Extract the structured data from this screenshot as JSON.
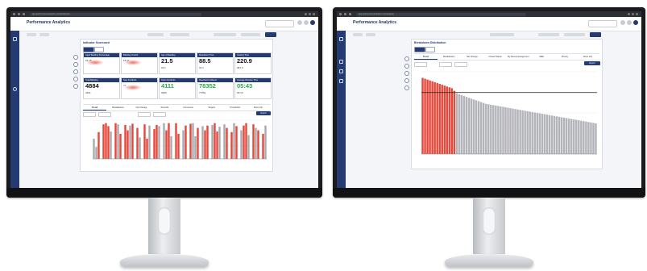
{
  "app": {
    "title": "Performance Analytics",
    "url_left": "app.performanceanalytics.com/dashboard",
    "url_right": "app.performanceanalytics.com/analysis"
  },
  "left_screen": {
    "page_title": "Indicator Scorecard",
    "cards": [
      {
        "label": "Aged Backlog Percentage",
        "value": "",
        "sub": "24.15",
        "color": "red"
      },
      {
        "label": "Backlog Growth",
        "value": "",
        "sub": "18.37",
        "color": "red"
      },
      {
        "label": "Age of Backlog",
        "value": "21.5",
        "sub": "22.1",
        "color": "black"
      },
      {
        "label": "Resolution Time",
        "value": "88.5",
        "sub": "31.1",
        "color": "black"
      },
      {
        "label": "Closing Time",
        "value": "220.9",
        "sub": "287.9",
        "color": "black"
      },
      {
        "label": "Total Backlog",
        "value": "4884",
        "sub": "4421",
        "color": "black"
      },
      {
        "label": "New Incidents",
        "value": "",
        "sub": "77",
        "color": "red"
      },
      {
        "label": "Open Incidents",
        "value": "4111",
        "sub": "3945",
        "color": "green"
      },
      {
        "label": "Resolved Incidents",
        "value": "78352",
        "sub": "77254",
        "color": "green"
      },
      {
        "label": "Average Resolve Time",
        "value": "05:43",
        "sub": "06:10",
        "color": "green"
      }
    ],
    "tabs": [
      "Trend",
      "Breakdowns",
      "Net Change",
      "Records",
      "Comments",
      "Targets",
      "Thresholds",
      "More Info"
    ],
    "export_label": "Export",
    "chart_data": {
      "type": "bar",
      "colors": {
        "highlight": "#e5473a",
        "base": "#a9aab0"
      },
      "values": [
        34,
        20,
        45,
        0,
        58,
        60,
        55,
        46,
        0,
        60,
        58,
        42,
        0,
        57,
        48,
        56,
        59,
        0,
        52,
        36,
        0,
        58,
        34,
        56,
        0,
        50,
        57,
        55,
        0,
        60,
        48,
        60,
        38,
        0,
        60,
        42,
        0,
        48,
        56,
        0,
        59,
        60,
        38,
        52,
        0,
        55,
        48,
        56,
        0,
        57,
        60,
        46,
        54,
        0,
        58,
        52,
        0,
        45,
        60,
        55,
        0,
        48,
        56,
        60,
        40,
        0,
        58,
        52,
        48,
        0,
        42,
        56
      ],
      "highlight": [
        false,
        false,
        true,
        false,
        true,
        true,
        true,
        false,
        false,
        true,
        false,
        true,
        false,
        true,
        true,
        false,
        true,
        false,
        true,
        false,
        false,
        true,
        true,
        false,
        false,
        true,
        true,
        false,
        false,
        false,
        true,
        true,
        false,
        false,
        true,
        true,
        false,
        false,
        true,
        false,
        true,
        false,
        false,
        true,
        false,
        false,
        true,
        true,
        false,
        false,
        true,
        true,
        false,
        false,
        false,
        true,
        false,
        true,
        false,
        true,
        false,
        false,
        true,
        true,
        false,
        false,
        true,
        false,
        true,
        false,
        true,
        false
      ]
    }
  },
  "right_screen": {
    "page_title": "Breakdown Distribution",
    "tabs": [
      "Trend",
      "Breakdowns",
      "Net Change",
      "Closed Status",
      "By Record Assignment",
      "SME",
      "Priority",
      "More Info"
    ],
    "export_label": "Export",
    "chart_data": {
      "type": "bar",
      "colors": {
        "highlight": "#e5473a",
        "base": "#b3b4b9",
        "threshold": "#222222"
      },
      "threshold": 71,
      "highlight_count": 14,
      "values": [
        88,
        87,
        86,
        85,
        84,
        83,
        82,
        81,
        80,
        79,
        78,
        77,
        76,
        73,
        70,
        69,
        68,
        67,
        66,
        65,
        64,
        63,
        62,
        61,
        60,
        59,
        58,
        57.5,
        57,
        56.5,
        56,
        55.5,
        55,
        54.5,
        54,
        53.5,
        53,
        52.5,
        52,
        51.5,
        51,
        50.5,
        50,
        49.5,
        49,
        48.5,
        48,
        47.5,
        47,
        46.5,
        46,
        45.5,
        45,
        44.5,
        44,
        43.5,
        43,
        42.5,
        42,
        41.5,
        41,
        40.5,
        40,
        39.5,
        39,
        38.5,
        38,
        37.5,
        37,
        36.5,
        36,
        35.5
      ]
    }
  }
}
